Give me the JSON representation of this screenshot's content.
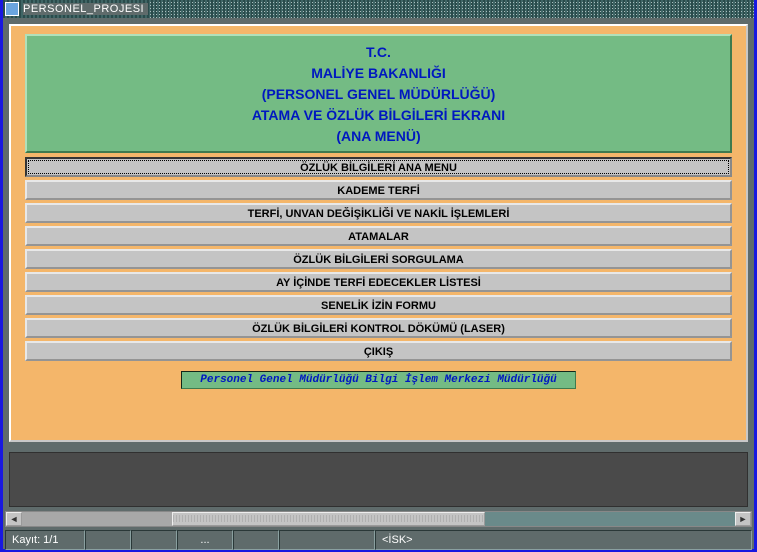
{
  "window": {
    "title": "PERSONEL_PROJESI"
  },
  "header": {
    "line1": "T.C.",
    "line2": "MALİYE BAKANLIĞI",
    "line3": "(PERSONEL GENEL MÜDÜRLÜĞÜ)",
    "line4": "ATAMA VE ÖZLÜK BİLGİLERİ EKRANI",
    "line5": "(ANA MENÜ)"
  },
  "menu": {
    "items": [
      "ÖZLÜK BİLGİLERİ ANA MENU",
      "KADEME TERFİ",
      "TERFİ, UNVAN  DEĞİŞİKLİĞİ VE NAKİL İŞLEMLERİ",
      "ATAMALAR",
      "ÖZLÜK BİLGİLERİ SORGULAMA",
      "AY İÇİNDE TERFİ EDECEKLER LİSTESİ",
      "SENELİK İZİN FORMU",
      "ÖZLÜK BİLGİLERİ KONTROL DÖKÜMÜ (LASER)",
      "ÇIKIŞ"
    ]
  },
  "footer": {
    "tagline": "Personel Genel Müdürlüğü Bilgi İşlem Merkezi Müdürlüğü"
  },
  "statusbar": {
    "record": "Kayıt: 1/1",
    "dots": "...",
    "mode": "<İSK>"
  }
}
